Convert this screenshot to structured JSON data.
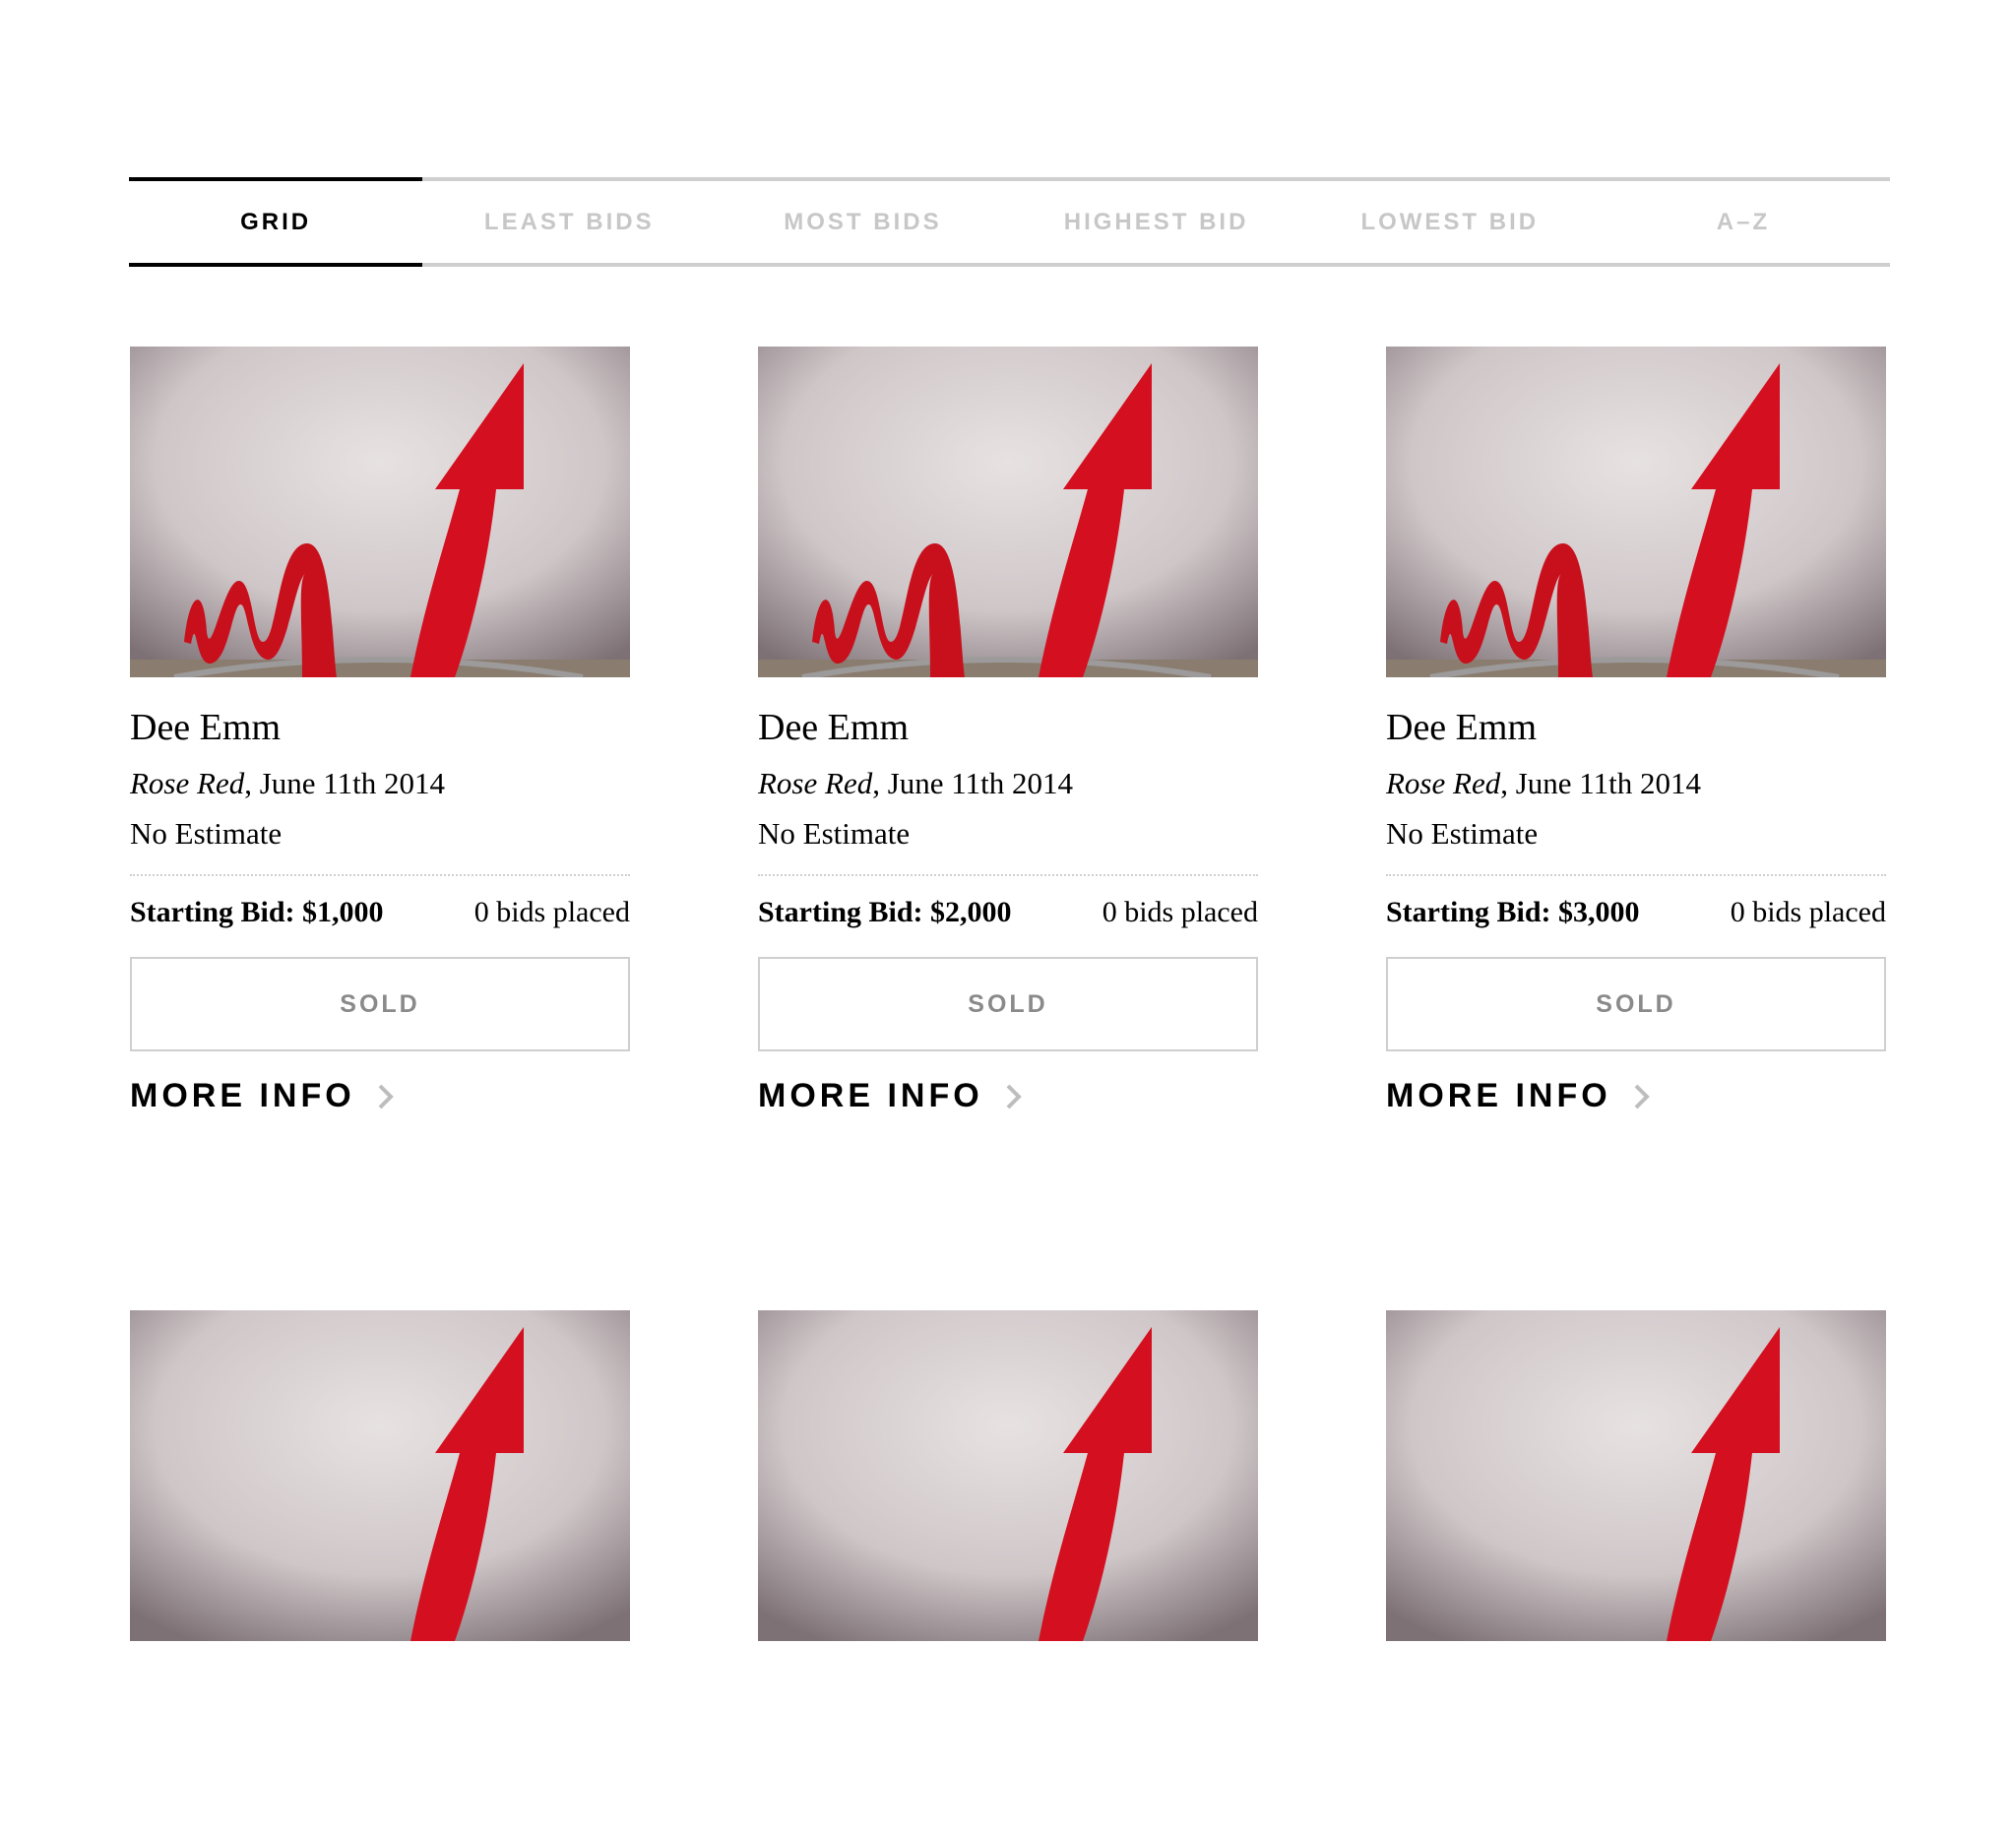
{
  "tabs": [
    {
      "label": "GRID",
      "active": true
    },
    {
      "label": "LEAST BIDS",
      "active": false
    },
    {
      "label": "MOST BIDS",
      "active": false
    },
    {
      "label": "HIGHEST BID",
      "active": false
    },
    {
      "label": "LOWEST BID",
      "active": false
    },
    {
      "label": "A–Z",
      "active": false
    }
  ],
  "lots": [
    {
      "artist": "Dee Emm",
      "title": "Rose Red",
      "date": ", June 11th 2014",
      "estimate": "No Estimate",
      "starting_bid": "Starting Bid: $1,000",
      "bids_placed": "0 bids placed",
      "button": "SOLD",
      "more_info": "MORE INFO"
    },
    {
      "artist": "Dee Emm",
      "title": "Rose Red",
      "date": ", June 11th 2014",
      "estimate": "No Estimate",
      "starting_bid": "Starting Bid: $2,000",
      "bids_placed": "0 bids placed",
      "button": "SOLD",
      "more_info": "MORE INFO"
    },
    {
      "artist": "Dee Emm",
      "title": "Rose Red",
      "date": ", June 11th 2014",
      "estimate": "No Estimate",
      "starting_bid": "Starting Bid: $3,000",
      "bids_placed": "0 bids placed",
      "button": "SOLD",
      "more_info": "MORE INFO"
    }
  ],
  "colors": {
    "artwork_red": "#d40f1f",
    "divider": "#cfcfcf",
    "inactive_tab": "#c7c7c7",
    "sold_text": "#8a8a8a"
  },
  "icons": {
    "more_info_arrow": "chevron-right-icon"
  }
}
